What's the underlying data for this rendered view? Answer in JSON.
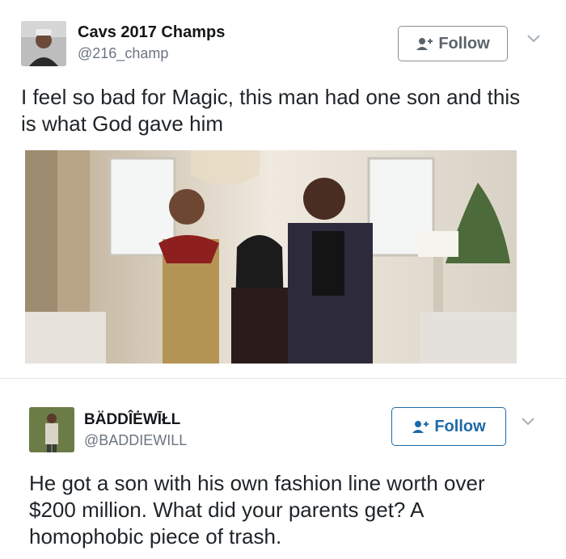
{
  "tweets": [
    {
      "display_name": "Cavs 2017 Champs",
      "handle": "@216_champ",
      "follow_label": "Follow",
      "text": "I feel so bad for Magic, this man had one son and this is what God gave him"
    },
    {
      "display_name": "BÄDDÎĖWĪŁL",
      "handle": "@BADDIEWILL",
      "follow_label": "Follow",
      "text": "He got a son with his own fashion line worth over $200 million. What did your parents get? A homophobic piece of trash."
    }
  ],
  "icons": {
    "follow": "add-user-icon",
    "menu": "chevron-down-icon",
    "avatar": "avatar"
  },
  "colors": {
    "follow_default": "#5a636c",
    "follow_active": "#1d6aa6",
    "handle": "#6a7480"
  }
}
